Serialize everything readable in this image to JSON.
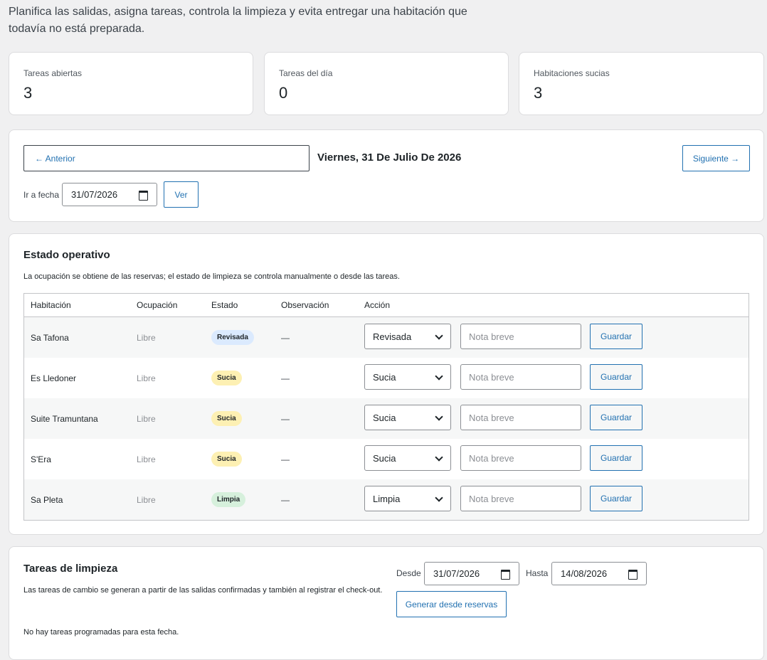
{
  "intro": "Planifica las salidas, asigna tareas, controla la limpieza y evita entregar una habitación que todavía no está preparada.",
  "stats": [
    {
      "label": "Tareas abiertas",
      "value": "3"
    },
    {
      "label": "Tareas del día",
      "value": "0"
    },
    {
      "label": "Habitaciones sucias",
      "value": "3"
    }
  ],
  "nav": {
    "prev": "← Anterior",
    "date_title": "Viernes, 31 De Julio De 2026",
    "next": "Siguiente →",
    "goto_label": "Ir a fecha",
    "goto_value": "31/07/2026",
    "view": "Ver"
  },
  "ops": {
    "title": "Estado operativo",
    "desc": "La ocupación se obtiene de las reservas; el estado de limpieza se controla manualmente o desde las tareas.",
    "headers": [
      "Habitación",
      "Ocupación",
      "Estado",
      "Observación",
      "Acción"
    ],
    "note_placeholder": "Nota breve",
    "save_label": "Guardar",
    "rows": [
      {
        "room": "Sa Tafona",
        "occupancy": "Libre",
        "status": "Revisada",
        "observation": "—",
        "select": "Revisada"
      },
      {
        "room": "Es Lledoner",
        "occupancy": "Libre",
        "status": "Sucia",
        "observation": "—",
        "select": "Sucia"
      },
      {
        "room": "Suite Tramuntana",
        "occupancy": "Libre",
        "status": "Sucia",
        "observation": "—",
        "select": "Sucia"
      },
      {
        "room": "S'Era",
        "occupancy": "Libre",
        "status": "Sucia",
        "observation": "—",
        "select": "Sucia"
      },
      {
        "room": "Sa Pleta",
        "occupancy": "Libre",
        "status": "Limpia",
        "observation": "—",
        "select": "Limpia"
      }
    ],
    "status_colors": {
      "Revisada": "#dbeafe",
      "Sucia": "#fdf0b3",
      "Limpia": "#d6f0dc"
    }
  },
  "tasks": {
    "title": "Tareas de limpieza",
    "desc": "Las tareas de cambio se generan a partir de las salidas confirmadas y también al registrar el check-out.",
    "from_label": "Desde",
    "from_value": "31/07/2026",
    "to_label": "Hasta",
    "to_value": "14/08/2026",
    "generate": "Generar desde reservas",
    "empty": "No hay tareas programadas para esta fecha."
  }
}
